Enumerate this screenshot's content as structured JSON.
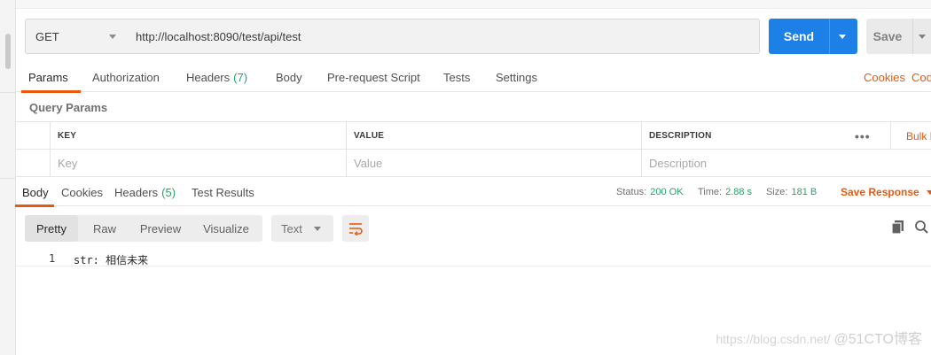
{
  "request": {
    "method": "GET",
    "url": "http://localhost:8090/test/api/test",
    "send_label": "Send",
    "save_label": "Save"
  },
  "request_tabs": [
    {
      "label": "Params",
      "active": true
    },
    {
      "label": "Authorization"
    },
    {
      "label": "Headers",
      "count": "(7)"
    },
    {
      "label": "Body"
    },
    {
      "label": "Pre-request Script"
    },
    {
      "label": "Tests"
    },
    {
      "label": "Settings"
    }
  ],
  "links": {
    "cookies": "Cookies",
    "code": "Code"
  },
  "query_params": {
    "title": "Query Params",
    "headers": {
      "key": "KEY",
      "value": "VALUE",
      "description": "DESCRIPTION"
    },
    "placeholders": {
      "key": "Key",
      "value": "Value",
      "description": "Description"
    },
    "more": "•••",
    "bulk_edit": "Bulk Edit"
  },
  "response_tabs": [
    {
      "label": "Body",
      "active": true
    },
    {
      "label": "Cookies"
    },
    {
      "label": "Headers",
      "count": "(5)"
    },
    {
      "label": "Test Results"
    }
  ],
  "response_meta": {
    "status_label": "Status:",
    "status_value": "200 OK",
    "time_label": "Time:",
    "time_value": "2.88 s",
    "size_label": "Size:",
    "size_value": "181 B",
    "save_response": "Save Response"
  },
  "view_modes": [
    "Pretty",
    "Raw",
    "Preview",
    "Visualize"
  ],
  "format": "Text",
  "response_body": {
    "line_number": "1",
    "text": "str: 相信未来"
  },
  "watermark": {
    "url": "https://blog.csdn.net/",
    "brand": "@51CTO博客"
  },
  "colors": {
    "accent": "#e8590c",
    "send": "#1d80e6",
    "ok": "#26a269"
  }
}
